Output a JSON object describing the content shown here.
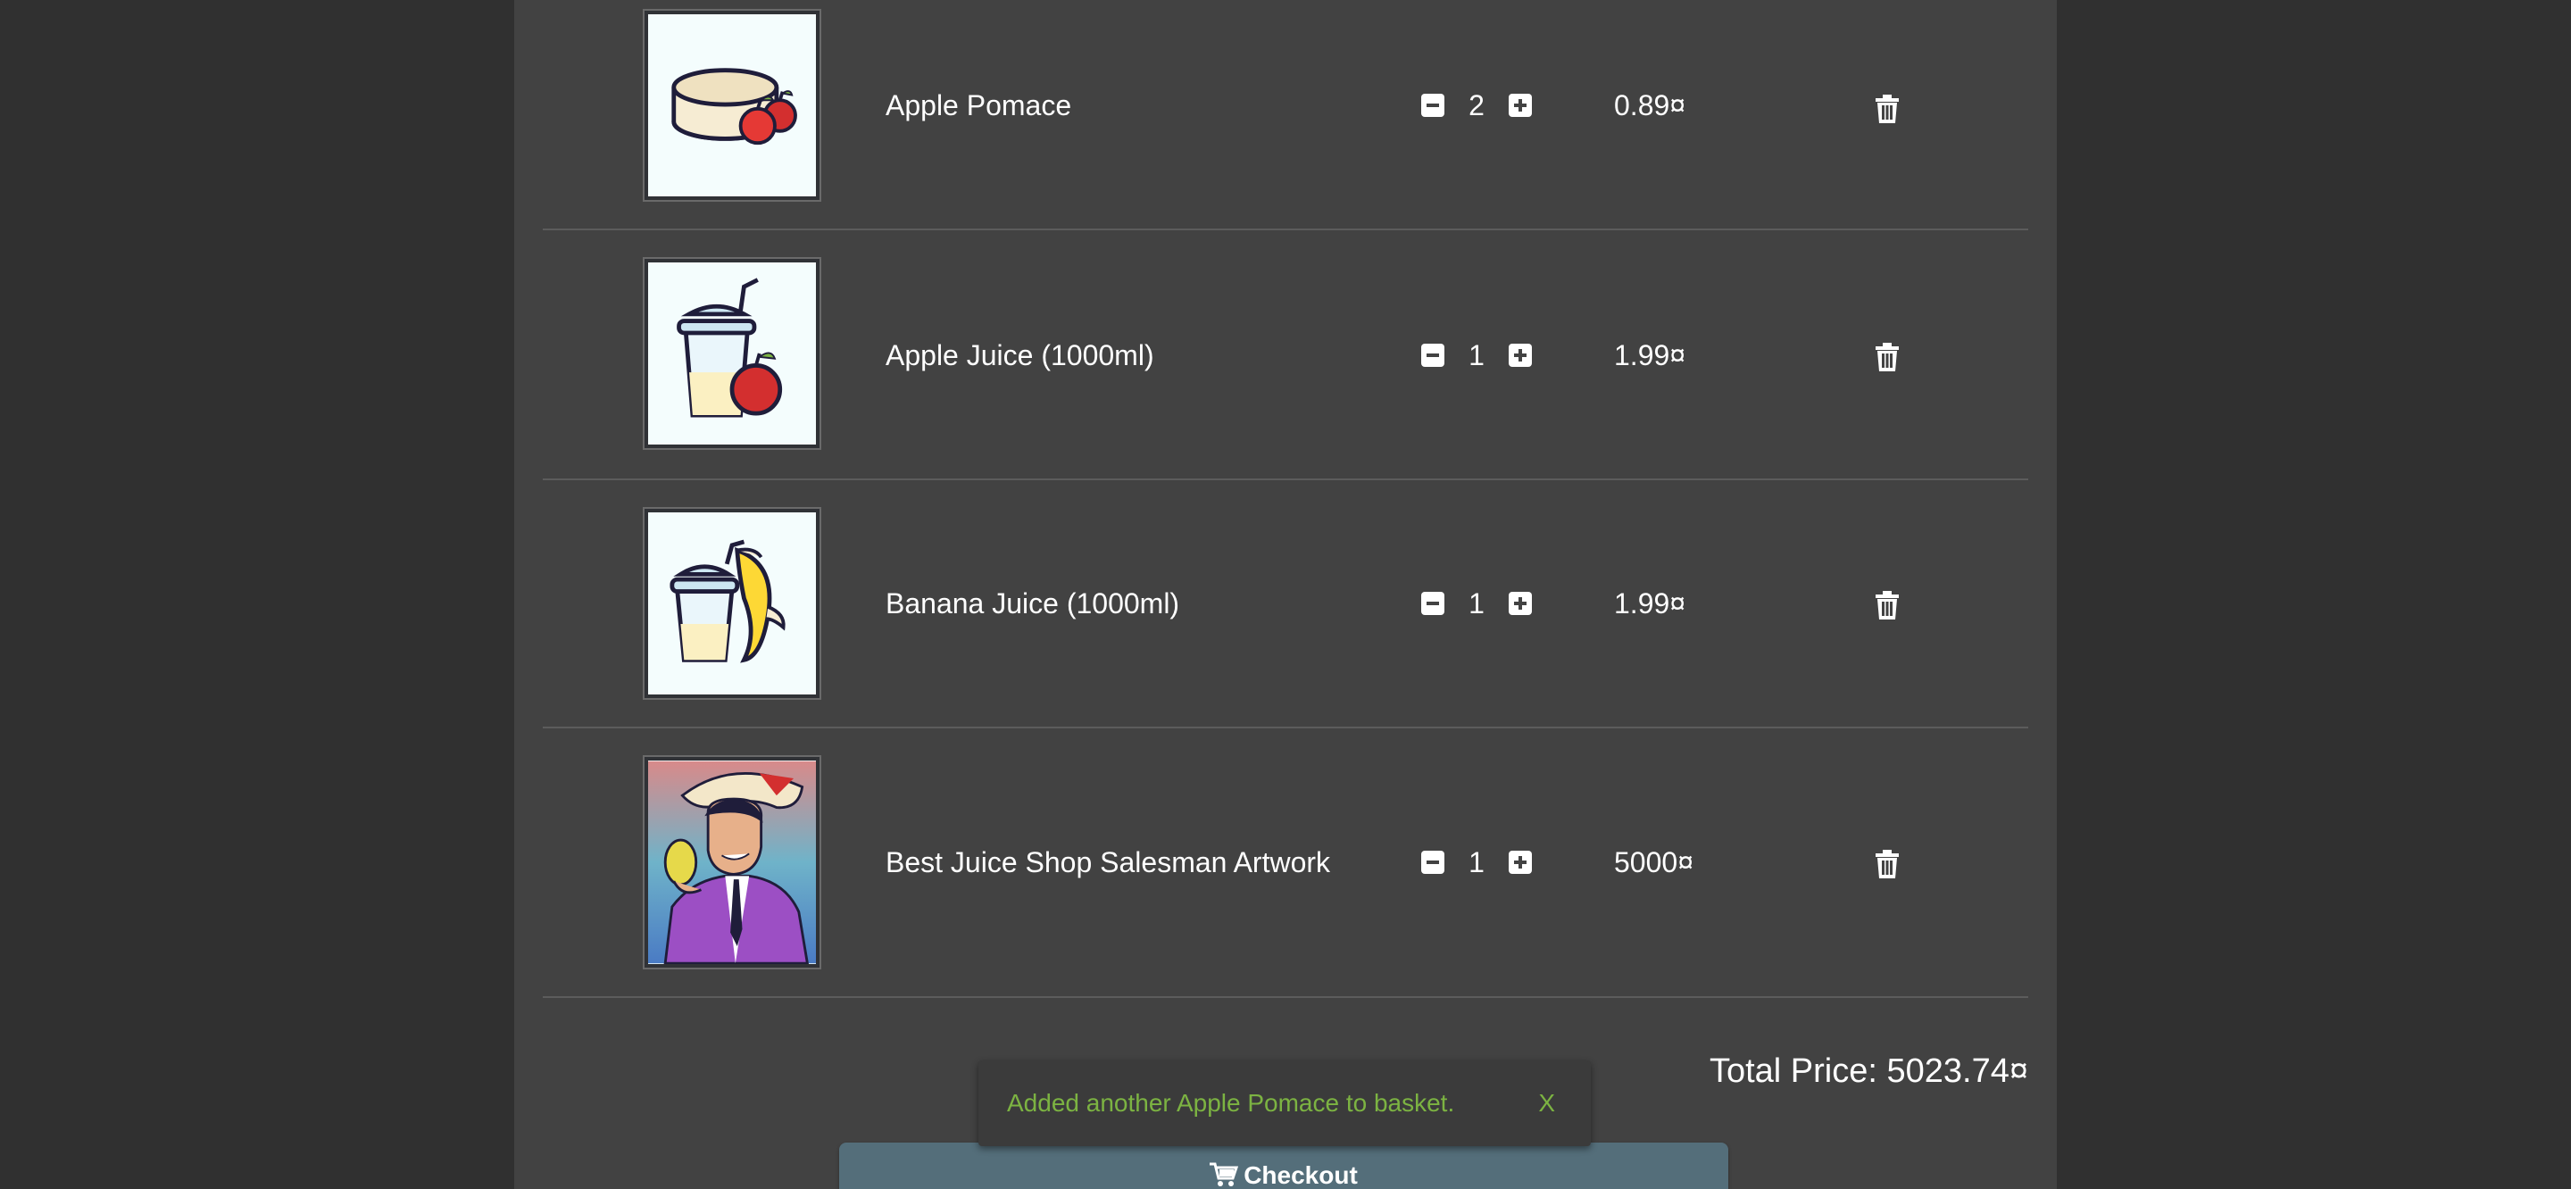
{
  "basket": {
    "items": [
      {
        "name": "Apple Pomace",
        "quantity": "2",
        "price": "0.89¤",
        "image": "apple-pomace-image"
      },
      {
        "name": "Apple Juice (1000ml)",
        "quantity": "1",
        "price": "1.99¤",
        "image": "apple-juice-image"
      },
      {
        "name": "Banana Juice (1000ml)",
        "quantity": "1",
        "price": "1.99¤",
        "image": "banana-juice-image"
      },
      {
        "name": "Best Juice Shop Salesman Artwork",
        "quantity": "1",
        "price": "5000¤",
        "image": "salesman-artwork-image"
      }
    ],
    "total_price": "Total Price: 5023.74¤",
    "checkout_label": "Checkout"
  },
  "snackbar": {
    "message": "Added another Apple Pomace to basket.",
    "close_label": "X"
  },
  "icons": {
    "decrease": "minus-square-icon",
    "increase": "plus-square-icon",
    "delete": "trash-icon",
    "checkout": "cart-icon"
  },
  "colors": {
    "background": "#303030",
    "panel": "#424242",
    "checkout_button": "#546e7a",
    "snackbar_text": "#7cb342"
  }
}
